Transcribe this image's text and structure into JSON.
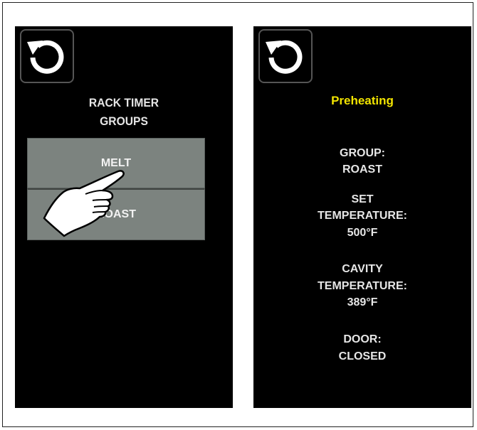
{
  "left_screen": {
    "title_line1": "RACK TIMER",
    "title_line2": "GROUPS",
    "groups": [
      {
        "label": "MELT"
      },
      {
        "label": "ROAST"
      }
    ]
  },
  "right_screen": {
    "status": "Preheating",
    "group_label": "GROUP:",
    "group_value": "ROAST",
    "set_temp_label1": "SET",
    "set_temp_label2": "TEMPERATURE:",
    "set_temp_value": "500°F",
    "cavity_temp_label1": "CAVITY",
    "cavity_temp_label2": "TEMPERATURE:",
    "cavity_temp_value": "389°F",
    "door_label": "DOOR:",
    "door_value": "CLOSED"
  },
  "colors": {
    "screen_bg": "#000000",
    "button_bg": "#7c837f",
    "status_text": "#f2e400"
  },
  "icons": [
    "reset-icon",
    "pointing-hand-icon"
  ]
}
